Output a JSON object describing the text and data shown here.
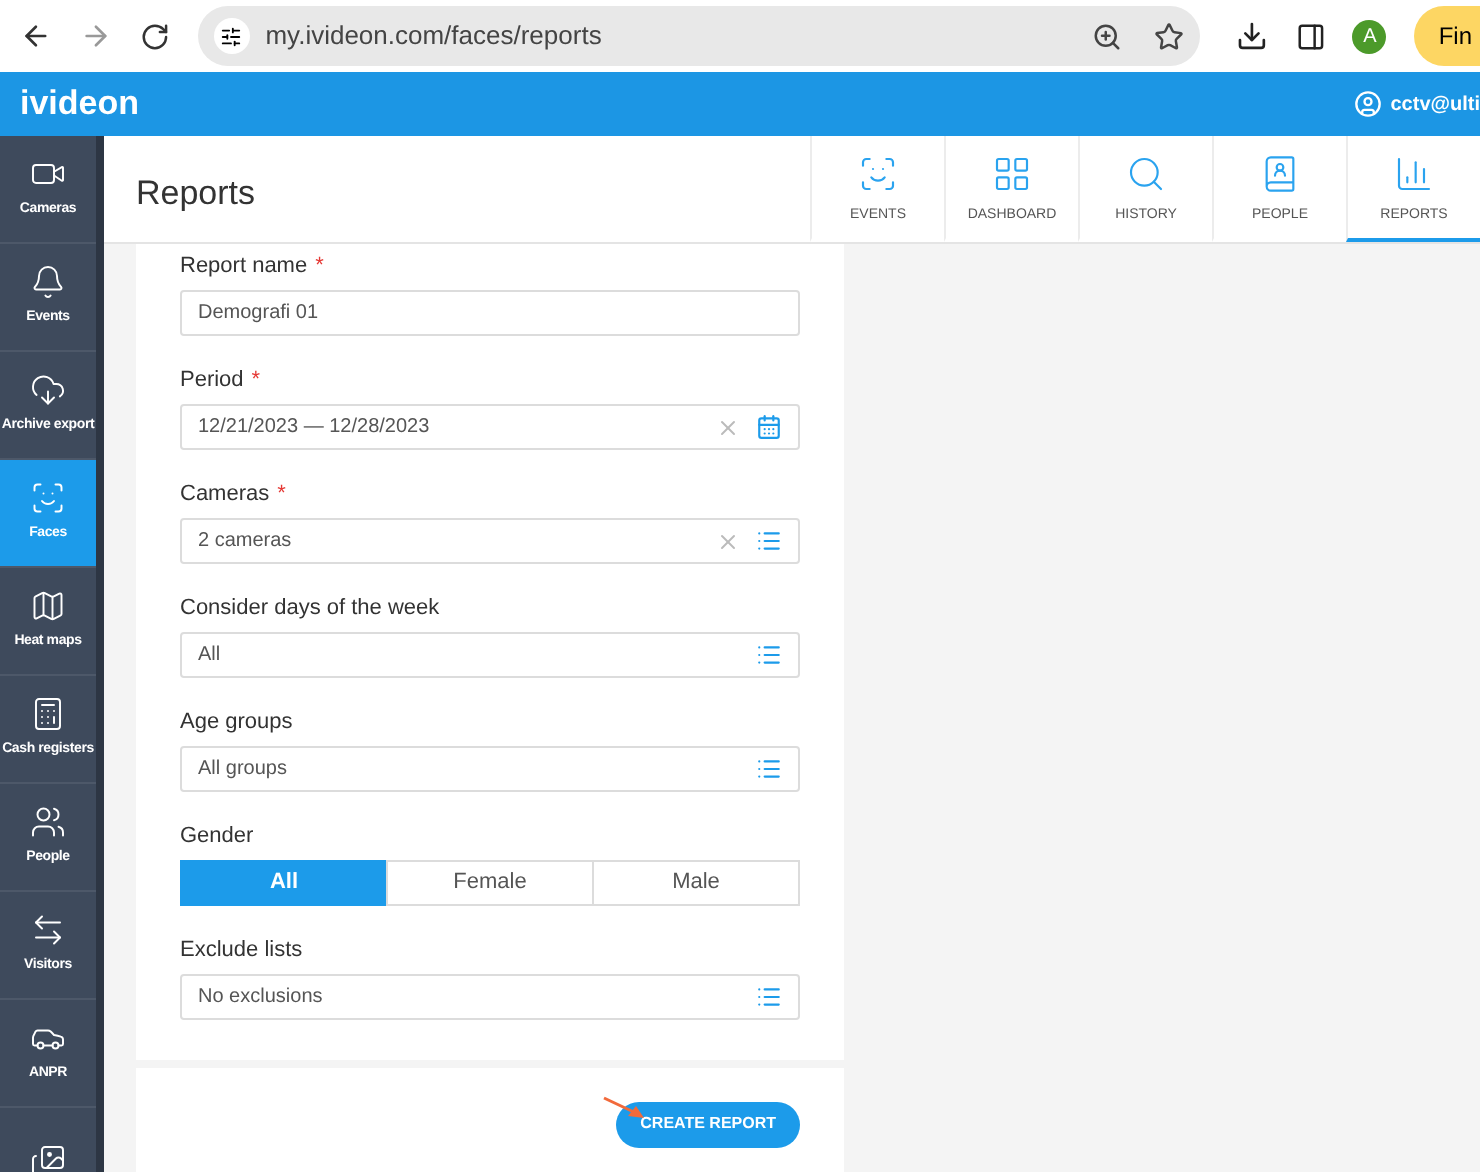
{
  "browser": {
    "url": "my.ivideon.com/faces/reports",
    "profile_initial": "A",
    "side_button": "Fin"
  },
  "header": {
    "logo": "ivideon",
    "user": "cctv@ulti"
  },
  "sidebar": {
    "items": [
      {
        "label": "Cameras",
        "selected": false
      },
      {
        "label": "Events",
        "selected": false
      },
      {
        "label": "Archive export",
        "selected": false
      },
      {
        "label": "Faces",
        "selected": true
      },
      {
        "label": "Heat maps",
        "selected": false
      },
      {
        "label": "Cash registers",
        "selected": false
      },
      {
        "label": "People",
        "selected": false
      },
      {
        "label": "Visitors",
        "selected": false
      },
      {
        "label": "ANPR",
        "selected": false
      },
      {
        "selected": false
      }
    ]
  },
  "page": {
    "title": "Reports"
  },
  "tabs": [
    {
      "label": "EVENTS",
      "selected": false
    },
    {
      "label": "DASHBOARD",
      "selected": false
    },
    {
      "label": "HISTORY",
      "selected": false
    },
    {
      "label": "PEOPLE",
      "selected": false
    },
    {
      "label": "REPORTS",
      "selected": true
    }
  ],
  "form": {
    "fields": [
      {
        "kind": "input",
        "label": "Report name",
        "required": true,
        "value": "Demografi 01"
      },
      {
        "kind": "date",
        "label": "Period",
        "required": true,
        "value": "12/21/2023 — 12/28/2023",
        "clearable": true
      },
      {
        "kind": "select",
        "label": "Cameras",
        "required": true,
        "value": "2 cameras",
        "clearable": true
      },
      {
        "kind": "select",
        "label": "Consider days of the week",
        "value": "All"
      },
      {
        "kind": "select",
        "label": "Age groups",
        "value": "All groups"
      },
      {
        "kind": "segmented",
        "label": "Gender",
        "options": [
          {
            "label": "All",
            "selected": true
          },
          {
            "label": "Female",
            "selected": false
          },
          {
            "label": "Male",
            "selected": false
          }
        ]
      },
      {
        "kind": "select",
        "label": "Exclude lists",
        "value": "No exclusions"
      }
    ],
    "required_mark": "*",
    "submit": "CREATE REPORT"
  }
}
